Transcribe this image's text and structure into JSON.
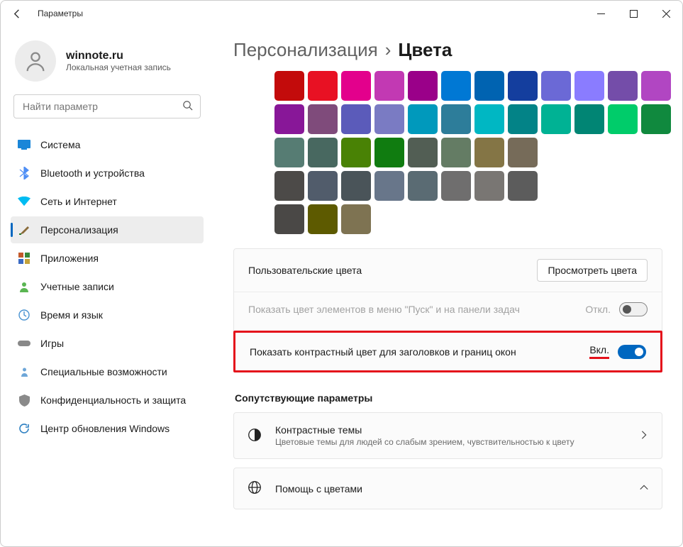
{
  "window": {
    "title": "Параметры"
  },
  "user": {
    "name": "winnote.ru",
    "subtitle": "Локальная учетная запись"
  },
  "search": {
    "placeholder": "Найти параметр"
  },
  "nav": {
    "items": [
      {
        "label": "Система",
        "icon": "system",
        "color": "#0078d4"
      },
      {
        "label": "Bluetooth и устройства",
        "icon": "bluetooth",
        "color": "#4e8ef5"
      },
      {
        "label": "Сеть и Интернет",
        "icon": "wifi",
        "color": "#00bcf2"
      },
      {
        "label": "Персонализация",
        "icon": "brush",
        "color": "#6b6b6b",
        "active": true
      },
      {
        "label": "Приложения",
        "icon": "apps",
        "color": "#9a6b3b"
      },
      {
        "label": "Учетные записи",
        "icon": "user",
        "color": "#5ab552"
      },
      {
        "label": "Время и язык",
        "icon": "globe-clock",
        "color": "#4a93d1"
      },
      {
        "label": "Игры",
        "icon": "gamepad",
        "color": "#888888"
      },
      {
        "label": "Специальные возможности",
        "icon": "person-arrows",
        "color": "#6da6d8"
      },
      {
        "label": "Конфиденциальность и защита",
        "icon": "shield",
        "color": "#8a8a8a"
      },
      {
        "label": "Центр обновления Windows",
        "icon": "windows-update",
        "color": "#2c7fc1"
      }
    ]
  },
  "breadcrumb": {
    "parent": "Персонализация",
    "current": "Цвета"
  },
  "colors": {
    "swatches": [
      "#c30b0b",
      "#e81123",
      "#e3008c",
      "#c239b3",
      "#9a0089",
      "#0078d4",
      "#0063b1",
      "#143e9e",
      "#6b69d6",
      "#8a7cff",
      "#744da9",
      "#b146c2",
      "#881798",
      "#7f4b7b",
      "#5b5bba",
      "#7a7bc3",
      "#0099bc",
      "#2d7d9a",
      "#00b7c3",
      "#038387",
      "#00b294",
      "#018574",
      "#00cc6a",
      "#10893e",
      "#567c73",
      "#486860",
      "#498205",
      "#107c10",
      "#525e54",
      "#647c64",
      "#847545",
      "#766b59",
      "#4c4a48",
      "#515c6b",
      "#4a5459",
      "#68768a",
      "#5a6b73",
      "#6f6e6e",
      "#797673",
      "#5c5c5c",
      "#4a4846",
      "#5d5a00",
      "#7e7352"
    ]
  },
  "settings": {
    "custom_label": "Пользовательские цвета",
    "view_button": "Просмотреть цвета",
    "start_taskbar_label": "Показать цвет элементов в меню \"Пуск\" и на панели задач",
    "start_taskbar_state": "Откл.",
    "titlebar_label": "Показать контрастный цвет для заголовков и границ окон",
    "titlebar_state": "Вкл."
  },
  "related": {
    "heading": "Сопутствующие параметры",
    "contrast_title": "Контрастные темы",
    "contrast_desc": "Цветовые темы для людей со слабым зрением, чувствительностью к цвету",
    "help_title": "Помощь с цветами"
  }
}
